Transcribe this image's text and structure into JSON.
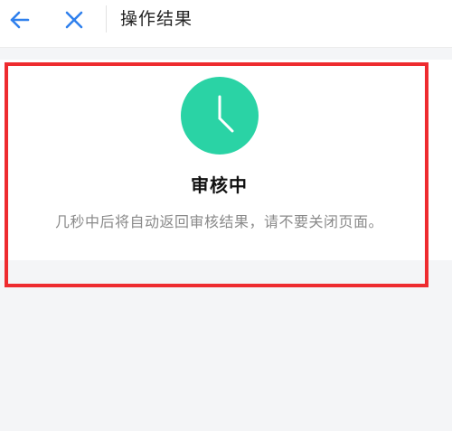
{
  "header": {
    "back_icon": "arrow-left-icon",
    "close_icon": "close-icon",
    "title": "操作结果"
  },
  "result": {
    "icon": "clock-icon",
    "title": "审核中",
    "description": "几秒中后将自动返回审核结果，请不要关闭页面。"
  },
  "colors": {
    "accent_blue": "#2f80ed",
    "status_green": "#2ad3a5",
    "highlight_red": "#ee2b2f"
  }
}
